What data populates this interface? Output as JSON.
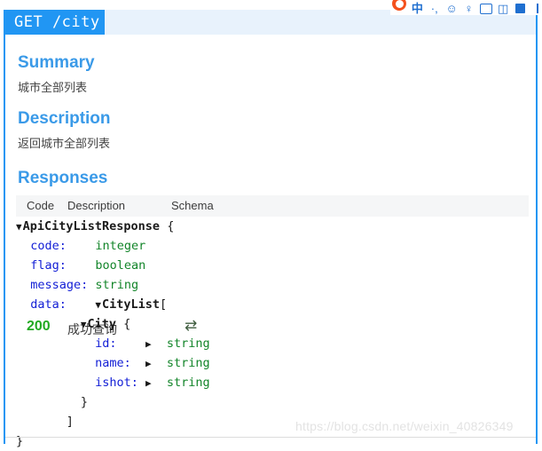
{
  "ime_bar": {
    "icons": [
      {
        "name": "sogou-logo-icon",
        "glyph": ""
      },
      {
        "name": "chinese-mode-icon",
        "glyph": "中"
      },
      {
        "name": "punctuation-mode-icon",
        "glyph": "·,"
      },
      {
        "name": "emoji-icon",
        "glyph": "☺"
      },
      {
        "name": "voice-input-icon",
        "glyph": "♁"
      },
      {
        "name": "soft-keyboard-icon",
        "glyph": ""
      },
      {
        "name": "toolbox-icon",
        "glyph": ""
      },
      {
        "name": "menu-icon",
        "glyph": ""
      }
    ]
  },
  "header": {
    "method": "GET",
    "path": "/city",
    "method_path": "GET /city"
  },
  "sections": {
    "summary_title": "Summary",
    "summary_text": "城市全部列表",
    "description_title": "Description",
    "description_text": "返回城市全部列表",
    "responses_title": "Responses"
  },
  "responses_table": {
    "columns": [
      "Code",
      "Description",
      "Schema"
    ],
    "rows": [
      {
        "code": "200",
        "description": "成功查询",
        "swap_icon": "⇄",
        "schema": {
          "lines": [
            {
              "indent": 0,
              "caret": "down",
              "label": "ApiCityListResponse",
              "punct": " {"
            },
            {
              "indent": 2,
              "caret": "none",
              "key": "code:",
              "pad": "    ",
              "type": "integer"
            },
            {
              "indent": 2,
              "caret": "none",
              "key": "flag:",
              "pad": "    ",
              "type": "boolean"
            },
            {
              "indent": 2,
              "caret": "none",
              "key": "message:",
              "pad": " ",
              "type": "string"
            },
            {
              "indent": 2,
              "caret": "none",
              "key": "data:",
              "pad": "    ",
              "nested_caret": "down",
              "label": "CityList",
              "punct": "["
            },
            {
              "indent": 9,
              "caret": "down",
              "label": "City",
              "punct": " {"
            },
            {
              "indent": 11,
              "caret": "none",
              "key": "id:",
              "pad": "    ",
              "expander": "right",
              "type": "string"
            },
            {
              "indent": 11,
              "caret": "none",
              "key": "name:",
              "pad": "  ",
              "expander": "right",
              "type": "string"
            },
            {
              "indent": 11,
              "caret": "none",
              "key": "ishot:",
              "pad": " ",
              "expander": "right",
              "type": "string"
            },
            {
              "indent": 9,
              "caret": "none",
              "punct_only": "}"
            },
            {
              "indent": 7,
              "caret": "none",
              "punct_only": "]"
            },
            {
              "indent": 0,
              "caret": "none",
              "punct_only": "}"
            }
          ]
        }
      }
    ]
  },
  "watermark": {
    "text": "https://blog.csdn.net/weixin_40826349"
  },
  "colors": {
    "accent_blue": "#2196f3",
    "header_tint": "#e8f2fc",
    "heading_blue": "#3a9ae8",
    "status_green": "#22aa22",
    "schema_key_blue": "#1420d6",
    "schema_type_green": "#13852a",
    "table_header_bg": "#f5f6f7"
  }
}
